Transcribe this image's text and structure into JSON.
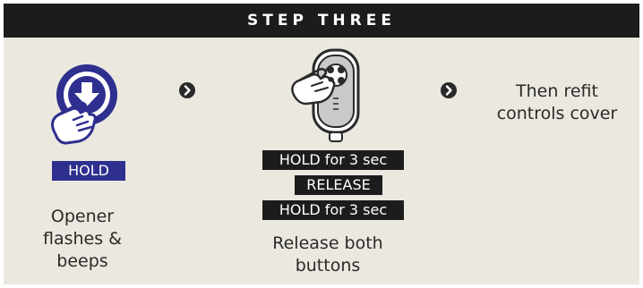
{
  "header": {
    "title": "STEP THREE"
  },
  "step1": {
    "icon": "press-down-button-icon",
    "label": "HOLD",
    "caption_lines": [
      "Opener",
      "flashes &",
      "beeps"
    ]
  },
  "step2": {
    "icon": "remote-control-press-icon",
    "labels": [
      "HOLD for 3 sec",
      "RELEASE",
      "HOLD for 3 sec"
    ],
    "caption_lines": [
      "Release both",
      "buttons"
    ]
  },
  "step3": {
    "caption_lines": [
      "Then refit",
      "controls cover"
    ]
  },
  "colors": {
    "header_bg": "#1c1c1c",
    "panel_bg": "#ebe8df",
    "accent_blue": "#2e2f8f",
    "text": "#2a2a2a"
  }
}
